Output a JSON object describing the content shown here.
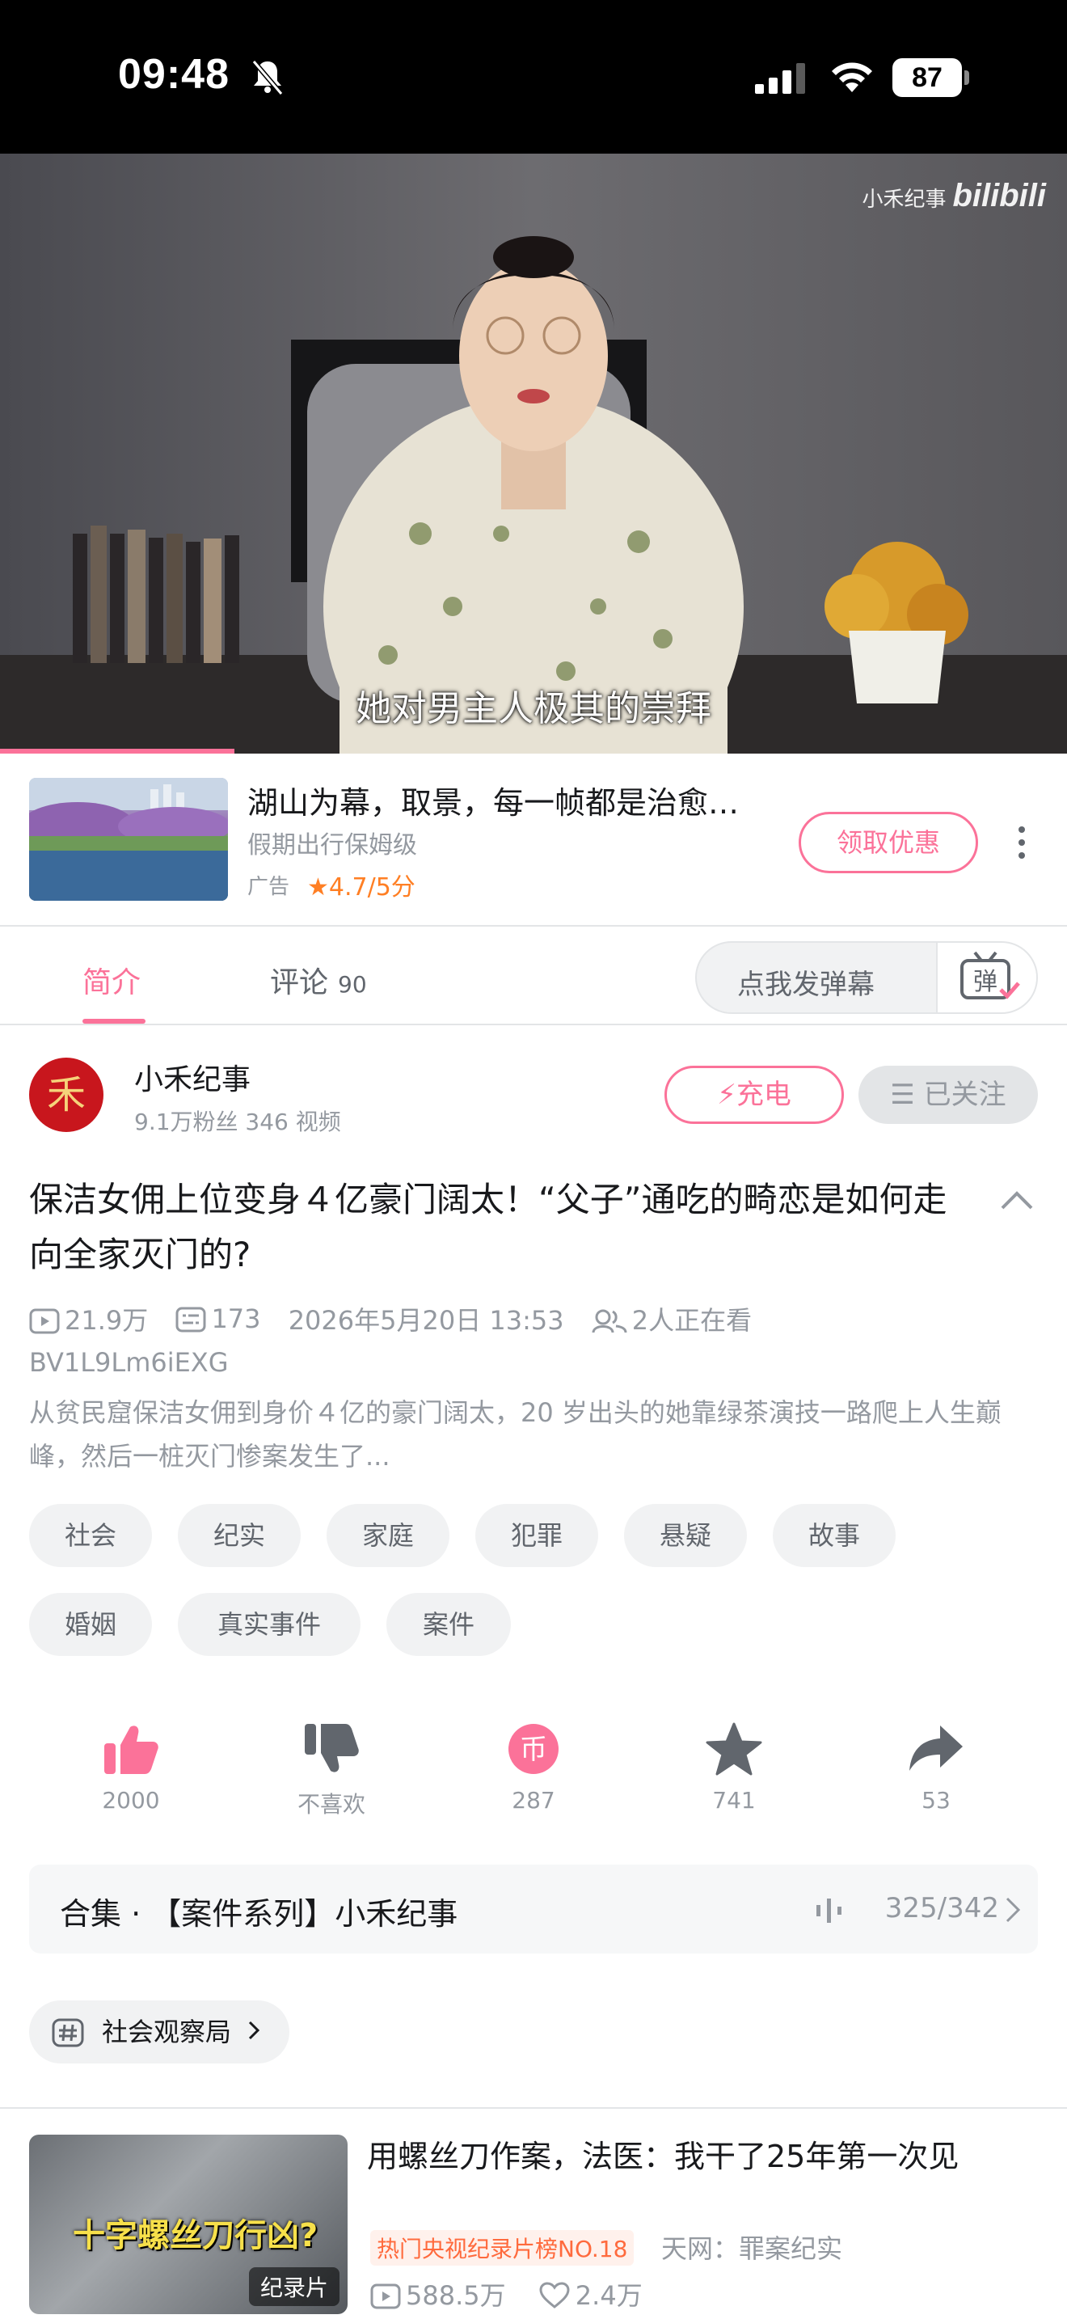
{
  "status_bar": {
    "time": "09:48",
    "battery": "87"
  },
  "video": {
    "watermark_channel": "小禾纪事",
    "watermark_brand": "bilibili",
    "subtitle": "她对男主人极其的崇拜",
    "progress_fraction": 0.22
  },
  "ad": {
    "title": "湖山为幕，取景，每一帧都是治愈…",
    "subtitle": "假期出行保姆级",
    "tag": "广告",
    "rating": "4.7/5分",
    "button": "领取优惠"
  },
  "tabs": {
    "intro": "简介",
    "comments": "评论",
    "comments_count": "90",
    "danmaku_placeholder": "点我发弹幕",
    "danmaku_icon_char": "弹"
  },
  "uploader": {
    "avatar_char": "禾",
    "name": "小禾纪事",
    "meta": "9.1万粉丝   346 视频",
    "charge_button": "充电",
    "follow_button": "已关注"
  },
  "video_info": {
    "title": "保洁女佣上位变身４亿豪门阔太！“父子”通吃的畸恋是如何走向全家灭门的?",
    "views": "21.9万",
    "danmaku_count": "173",
    "date": "2026年5月20日 13:53",
    "watching": "2人正在看",
    "bvid": "BV1L9Lm6iEXG",
    "description": "从贫民窟保洁女佣到身价４亿的豪门阔太，20 岁出头的她靠绿茶演技一路爬上人生巅峰，然后一桩灭门惨案发生了..."
  },
  "tags": [
    "社会",
    "纪实",
    "家庭",
    "犯罪",
    "悬疑",
    "故事",
    "婚姻",
    "真实事件",
    "案件"
  ],
  "actions": {
    "like": "2000",
    "dislike": "不喜欢",
    "coin": "287",
    "favorite": "741",
    "share": "53"
  },
  "collection": {
    "label": "合集 · 【案件系列】小禾纪事",
    "progress": "325/342"
  },
  "topic": {
    "label": "社会观察局"
  },
  "recommended": {
    "thumb_text": "十字螺丝刀行凶?",
    "badge": "纪录片",
    "title": "用螺丝刀作案，法医：我干了25年第一次见",
    "rank": "热门央视纪录片榜NO.18",
    "uploader": "天网：罪案纪实",
    "views": "588.5万",
    "likes": "2.4万"
  },
  "colors": {
    "accent": "#fb7299",
    "rating": "#ff7f24",
    "secondary_text": "#9499a0"
  }
}
